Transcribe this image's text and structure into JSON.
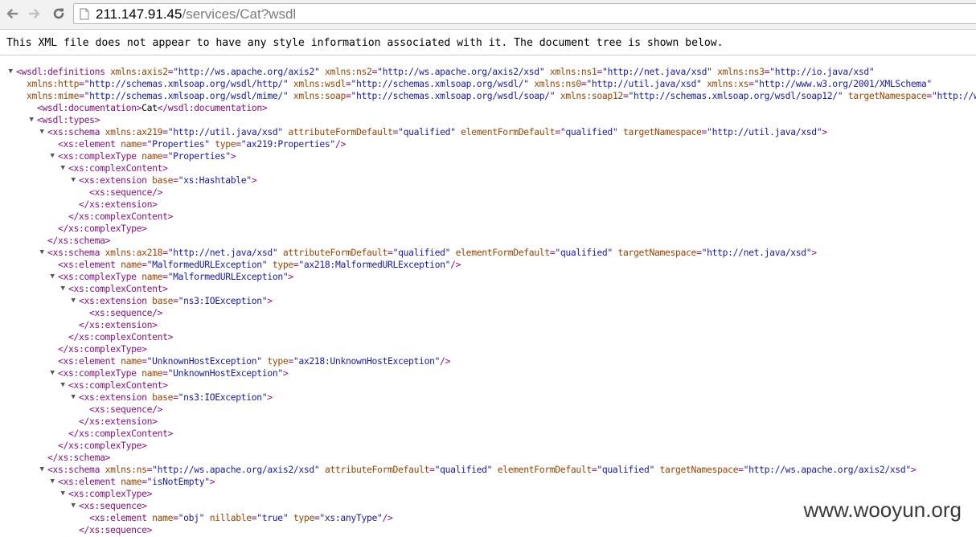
{
  "browser": {
    "url_host": "211.147.91.45",
    "url_path": "/services/Cat?wsdl"
  },
  "notice": "This XML file does not appear to have any style information associated with it. The document tree is shown below.",
  "lines": [
    {
      "indent": 0,
      "tog": "open",
      "p": [
        [
          "t",
          "<wsdl:definitions "
        ],
        [
          "an",
          "xmlns:axis2"
        ],
        [
          "t",
          "="
        ],
        [
          "av",
          "\"http://ws.apache.org/axis2\""
        ],
        [
          "t",
          " "
        ],
        [
          "an",
          "xmlns:ns2"
        ],
        [
          "t",
          "="
        ],
        [
          "av",
          "\"http://ws.apache.org/axis2/xsd\""
        ],
        [
          "t",
          " "
        ],
        [
          "an",
          "xmlns:ns1"
        ],
        [
          "t",
          "="
        ],
        [
          "av",
          "\"http://net.java/xsd\""
        ],
        [
          "t",
          " "
        ],
        [
          "an",
          "xmlns:ns3"
        ],
        [
          "t",
          "="
        ],
        [
          "av",
          "\"http://io.java/xsd\""
        ]
      ]
    },
    {
      "indent": 1,
      "p": [
        [
          "an",
          "xmlns:http"
        ],
        [
          "t",
          "="
        ],
        [
          "av",
          "\"http://schemas.xmlsoap.org/wsdl/http/\""
        ],
        [
          "t",
          " "
        ],
        [
          "an",
          "xmlns:wsdl"
        ],
        [
          "t",
          "="
        ],
        [
          "av",
          "\"http://schemas.xmlsoap.org/wsdl/\""
        ],
        [
          "t",
          " "
        ],
        [
          "an",
          "xmlns:ns0"
        ],
        [
          "t",
          "="
        ],
        [
          "av",
          "\"http://util.java/xsd\""
        ],
        [
          "t",
          " "
        ],
        [
          "an",
          "xmlns:xs"
        ],
        [
          "t",
          "="
        ],
        [
          "av",
          "\"http://www.w3.org/2001/XMLSchema\""
        ]
      ]
    },
    {
      "indent": 1,
      "p": [
        [
          "an",
          "xmlns:mime"
        ],
        [
          "t",
          "="
        ],
        [
          "av",
          "\"http://schemas.xmlsoap.org/wsdl/mime/\""
        ],
        [
          "t",
          " "
        ],
        [
          "an",
          "xmlns:soap"
        ],
        [
          "t",
          "="
        ],
        [
          "av",
          "\"http://schemas.xmlsoap.org/wsdl/soap/\""
        ],
        [
          "t",
          " "
        ],
        [
          "an",
          "xmlns:soap12"
        ],
        [
          "t",
          "="
        ],
        [
          "av",
          "\"http://schemas.xmlsoap.org/wsdl/soap12/\""
        ],
        [
          "t",
          " "
        ],
        [
          "an",
          "targetNamespace"
        ],
        [
          "t",
          "="
        ],
        [
          "av",
          "\"http://ws."
        ]
      ]
    },
    {
      "indent": 2,
      "p": [
        [
          "t",
          "<wsdl:documentation>"
        ],
        [
          "tx",
          "Cat"
        ],
        [
          "t",
          "</wsdl:documentation>"
        ]
      ]
    },
    {
      "indent": 2,
      "tog": "open",
      "p": [
        [
          "t",
          "<wsdl:types>"
        ]
      ]
    },
    {
      "indent": 3,
      "tog": "open",
      "p": [
        [
          "t",
          "<xs:schema "
        ],
        [
          "an",
          "xmlns:ax219"
        ],
        [
          "t",
          "="
        ],
        [
          "av",
          "\"http://util.java/xsd\""
        ],
        [
          "t",
          " "
        ],
        [
          "an",
          "attributeFormDefault"
        ],
        [
          "t",
          "="
        ],
        [
          "av",
          "\"qualified\""
        ],
        [
          "t",
          " "
        ],
        [
          "an",
          "elementFormDefault"
        ],
        [
          "t",
          "="
        ],
        [
          "av",
          "\"qualified\""
        ],
        [
          "t",
          " "
        ],
        [
          "an",
          "targetNamespace"
        ],
        [
          "t",
          "="
        ],
        [
          "av",
          "\"http://util.java/xsd\""
        ],
        [
          "t",
          ">"
        ]
      ]
    },
    {
      "indent": 4,
      "p": [
        [
          "t",
          "<xs:element "
        ],
        [
          "an",
          "name"
        ],
        [
          "t",
          "="
        ],
        [
          "av",
          "\"Properties\""
        ],
        [
          "t",
          " "
        ],
        [
          "an",
          "type"
        ],
        [
          "t",
          "="
        ],
        [
          "av",
          "\"ax219:Properties\""
        ],
        [
          "t",
          "/>"
        ]
      ]
    },
    {
      "indent": 4,
      "tog": "open",
      "p": [
        [
          "t",
          "<xs:complexType "
        ],
        [
          "an",
          "name"
        ],
        [
          "t",
          "="
        ],
        [
          "av",
          "\"Properties\""
        ],
        [
          "t",
          ">"
        ]
      ]
    },
    {
      "indent": 5,
      "tog": "open",
      "p": [
        [
          "t",
          "<xs:complexContent>"
        ]
      ]
    },
    {
      "indent": 6,
      "tog": "open",
      "p": [
        [
          "t",
          "<xs:extension "
        ],
        [
          "an",
          "base"
        ],
        [
          "t",
          "="
        ],
        [
          "av",
          "\"xs:Hashtable\""
        ],
        [
          "t",
          ">"
        ]
      ]
    },
    {
      "indent": 7,
      "p": [
        [
          "t",
          "<xs:sequence/>"
        ]
      ]
    },
    {
      "indent": 6,
      "p": [
        [
          "t",
          "</xs:extension>"
        ]
      ]
    },
    {
      "indent": 5,
      "p": [
        [
          "t",
          "</xs:complexContent>"
        ]
      ]
    },
    {
      "indent": 4,
      "p": [
        [
          "t",
          "</xs:complexType>"
        ]
      ]
    },
    {
      "indent": 3,
      "p": [
        [
          "t",
          "</xs:schema>"
        ]
      ]
    },
    {
      "indent": 3,
      "tog": "open",
      "p": [
        [
          "t",
          "<xs:schema "
        ],
        [
          "an",
          "xmlns:ax218"
        ],
        [
          "t",
          "="
        ],
        [
          "av",
          "\"http://net.java/xsd\""
        ],
        [
          "t",
          " "
        ],
        [
          "an",
          "attributeFormDefault"
        ],
        [
          "t",
          "="
        ],
        [
          "av",
          "\"qualified\""
        ],
        [
          "t",
          " "
        ],
        [
          "an",
          "elementFormDefault"
        ],
        [
          "t",
          "="
        ],
        [
          "av",
          "\"qualified\""
        ],
        [
          "t",
          " "
        ],
        [
          "an",
          "targetNamespace"
        ],
        [
          "t",
          "="
        ],
        [
          "av",
          "\"http://net.java/xsd\""
        ],
        [
          "t",
          ">"
        ]
      ]
    },
    {
      "indent": 4,
      "p": [
        [
          "t",
          "<xs:element "
        ],
        [
          "an",
          "name"
        ],
        [
          "t",
          "="
        ],
        [
          "av",
          "\"MalformedURLException\""
        ],
        [
          "t",
          " "
        ],
        [
          "an",
          "type"
        ],
        [
          "t",
          "="
        ],
        [
          "av",
          "\"ax218:MalformedURLException\""
        ],
        [
          "t",
          "/>"
        ]
      ]
    },
    {
      "indent": 4,
      "tog": "open",
      "p": [
        [
          "t",
          "<xs:complexType "
        ],
        [
          "an",
          "name"
        ],
        [
          "t",
          "="
        ],
        [
          "av",
          "\"MalformedURLException\""
        ],
        [
          "t",
          ">"
        ]
      ]
    },
    {
      "indent": 5,
      "tog": "open",
      "p": [
        [
          "t",
          "<xs:complexContent>"
        ]
      ]
    },
    {
      "indent": 6,
      "tog": "open",
      "p": [
        [
          "t",
          "<xs:extension "
        ],
        [
          "an",
          "base"
        ],
        [
          "t",
          "="
        ],
        [
          "av",
          "\"ns3:IOException\""
        ],
        [
          "t",
          ">"
        ]
      ]
    },
    {
      "indent": 7,
      "p": [
        [
          "t",
          "<xs:sequence/>"
        ]
      ]
    },
    {
      "indent": 6,
      "p": [
        [
          "t",
          "</xs:extension>"
        ]
      ]
    },
    {
      "indent": 5,
      "p": [
        [
          "t",
          "</xs:complexContent>"
        ]
      ]
    },
    {
      "indent": 4,
      "p": [
        [
          "t",
          "</xs:complexType>"
        ]
      ]
    },
    {
      "indent": 4,
      "p": [
        [
          "t",
          "<xs:element "
        ],
        [
          "an",
          "name"
        ],
        [
          "t",
          "="
        ],
        [
          "av",
          "\"UnknownHostException\""
        ],
        [
          "t",
          " "
        ],
        [
          "an",
          "type"
        ],
        [
          "t",
          "="
        ],
        [
          "av",
          "\"ax218:UnknownHostException\""
        ],
        [
          "t",
          "/>"
        ]
      ]
    },
    {
      "indent": 4,
      "tog": "open",
      "p": [
        [
          "t",
          "<xs:complexType "
        ],
        [
          "an",
          "name"
        ],
        [
          "t",
          "="
        ],
        [
          "av",
          "\"UnknownHostException\""
        ],
        [
          "t",
          ">"
        ]
      ]
    },
    {
      "indent": 5,
      "tog": "open",
      "p": [
        [
          "t",
          "<xs:complexContent>"
        ]
      ]
    },
    {
      "indent": 6,
      "tog": "open",
      "p": [
        [
          "t",
          "<xs:extension "
        ],
        [
          "an",
          "base"
        ],
        [
          "t",
          "="
        ],
        [
          "av",
          "\"ns3:IOException\""
        ],
        [
          "t",
          ">"
        ]
      ]
    },
    {
      "indent": 7,
      "p": [
        [
          "t",
          "<xs:sequence/>"
        ]
      ]
    },
    {
      "indent": 6,
      "p": [
        [
          "t",
          "</xs:extension>"
        ]
      ]
    },
    {
      "indent": 5,
      "p": [
        [
          "t",
          "</xs:complexContent>"
        ]
      ]
    },
    {
      "indent": 4,
      "p": [
        [
          "t",
          "</xs:complexType>"
        ]
      ]
    },
    {
      "indent": 3,
      "p": [
        [
          "t",
          "</xs:schema>"
        ]
      ]
    },
    {
      "indent": 3,
      "tog": "open",
      "p": [
        [
          "t",
          "<xs:schema "
        ],
        [
          "an",
          "xmlns:ns"
        ],
        [
          "t",
          "="
        ],
        [
          "av",
          "\"http://ws.apache.org/axis2/xsd\""
        ],
        [
          "t",
          " "
        ],
        [
          "an",
          "attributeFormDefault"
        ],
        [
          "t",
          "="
        ],
        [
          "av",
          "\"qualified\""
        ],
        [
          "t",
          " "
        ],
        [
          "an",
          "elementFormDefault"
        ],
        [
          "t",
          "="
        ],
        [
          "av",
          "\"qualified\""
        ],
        [
          "t",
          " "
        ],
        [
          "an",
          "targetNamespace"
        ],
        [
          "t",
          "="
        ],
        [
          "av",
          "\"http://ws.apache.org/axis2/xsd\""
        ],
        [
          "t",
          ">"
        ]
      ]
    },
    {
      "indent": 4,
      "tog": "open",
      "p": [
        [
          "t",
          "<xs:element "
        ],
        [
          "an",
          "name"
        ],
        [
          "t",
          "="
        ],
        [
          "av",
          "\"isNotEmpty\""
        ],
        [
          "t",
          ">"
        ]
      ]
    },
    {
      "indent": 5,
      "tog": "open",
      "p": [
        [
          "t",
          "<xs:complexType>"
        ]
      ]
    },
    {
      "indent": 6,
      "tog": "open",
      "p": [
        [
          "t",
          "<xs:sequence>"
        ]
      ]
    },
    {
      "indent": 7,
      "p": [
        [
          "t",
          "<xs:element "
        ],
        [
          "an",
          "name"
        ],
        [
          "t",
          "="
        ],
        [
          "av",
          "\"obj\""
        ],
        [
          "t",
          " "
        ],
        [
          "an",
          "nillable"
        ],
        [
          "t",
          "="
        ],
        [
          "av",
          "\"true\""
        ],
        [
          "t",
          " "
        ],
        [
          "an",
          "type"
        ],
        [
          "t",
          "="
        ],
        [
          "av",
          "\"xs:anyType\""
        ],
        [
          "t",
          "/>"
        ]
      ]
    },
    {
      "indent": 6,
      "p": [
        [
          "t",
          "</xs:sequence>"
        ]
      ]
    }
  ],
  "watermark": "www.wooyun.org",
  "icons": {
    "back": "back-arrow-icon",
    "forward": "forward-arrow-icon",
    "reload": "reload-icon",
    "page": "page-icon",
    "toggle_open": "▼"
  }
}
